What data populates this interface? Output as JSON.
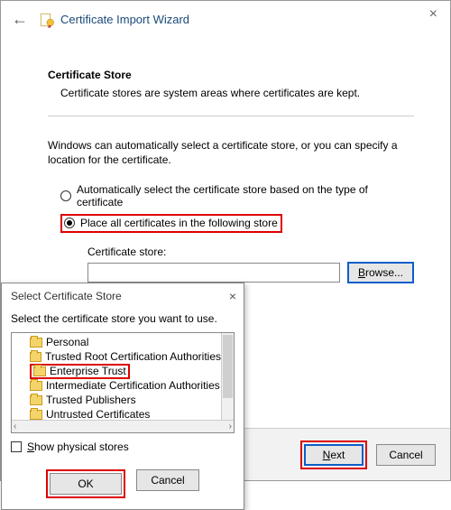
{
  "titlebar": {
    "title": "Certificate Import Wizard"
  },
  "section": {
    "heading": "Certificate Store",
    "description": "Certificate stores are system areas where certificates are kept."
  },
  "instruction": "Windows can automatically select a certificate store, or you can specify a location for the certificate.",
  "radios": {
    "auto": "Automatically select the certificate store based on the type of certificate",
    "place": "Place all certificates in the following store"
  },
  "store": {
    "label": "Certificate store:",
    "value": "",
    "browse_label_pre": "B",
    "browse_label_post": "rowse..."
  },
  "footer": {
    "next_pre": "",
    "next_u": "N",
    "next_post": "ext",
    "cancel": "Cancel"
  },
  "modal": {
    "title": "Select Certificate Store",
    "instruction": "Select the certificate store you want to use.",
    "items": [
      "Personal",
      "Trusted Root Certification Authorities",
      "Enterprise Trust",
      "Intermediate Certification Authorities",
      "Trusted Publishers",
      "Untrusted Certificates"
    ],
    "show_physical_pre": "",
    "show_physical_u": "S",
    "show_physical_post": "how physical stores",
    "ok": "OK",
    "cancel": "Cancel"
  }
}
